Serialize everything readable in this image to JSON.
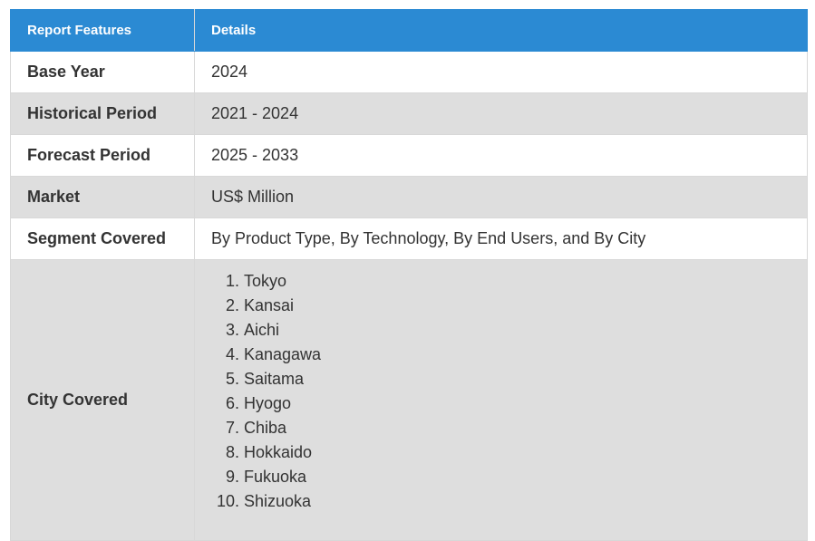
{
  "table": {
    "headers": {
      "feature": "Report Features",
      "details": "Details"
    },
    "rows": [
      {
        "feature": "Base Year",
        "details": "2024"
      },
      {
        "feature": "Historical Period",
        "details": "2021 - 2024"
      },
      {
        "feature": "Forecast Period",
        "details": "2025 - 2033"
      },
      {
        "feature": "Market",
        "details": "US$ Million"
      },
      {
        "feature": "Segment Covered",
        "details": "By Product Type, By Technology, By End Users, and By City"
      }
    ],
    "city_row": {
      "feature": "City Covered",
      "cities": [
        "Tokyo",
        "Kansai",
        "Aichi",
        "Kanagawa",
        "Saitama",
        "Hyogo",
        "Chiba",
        "Hokkaido",
        "Fukuoka",
        "Shizuoka"
      ]
    }
  },
  "colors": {
    "header_bg": "#2b8ad3",
    "stripe_bg": "#dedede",
    "border": "#d8d8d8"
  }
}
